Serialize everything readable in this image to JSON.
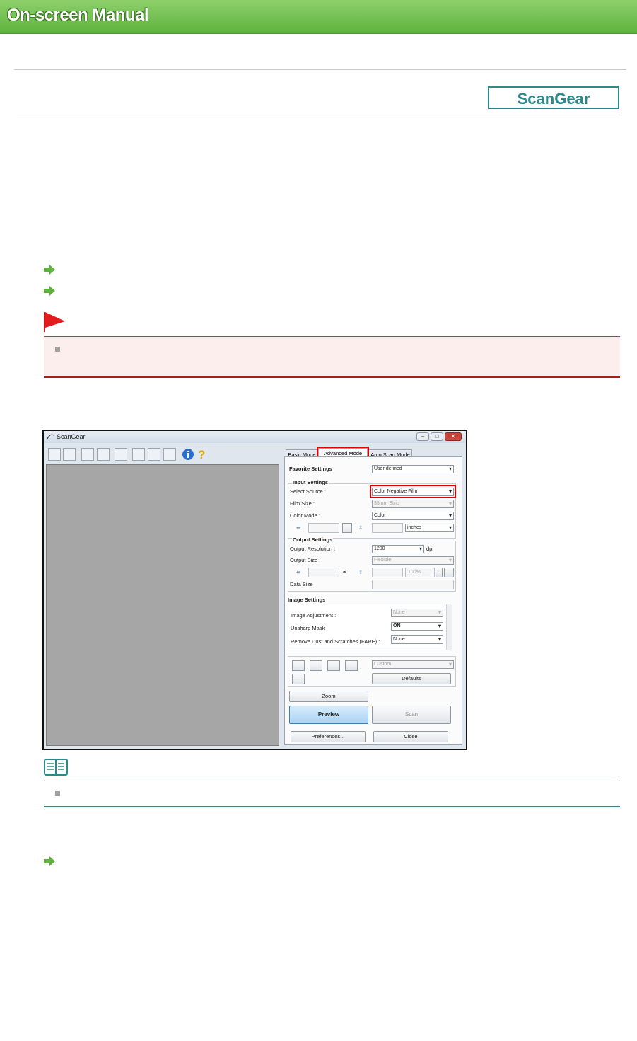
{
  "header": {
    "title": "On-screen Manual"
  },
  "badge": {
    "label": "ScanGear"
  },
  "window": {
    "title": "ScanGear",
    "tabs": [
      "Basic Mode",
      "Advanced Mode",
      "Auto Scan Mode"
    ],
    "favorite": {
      "label": "Favorite Settings",
      "value": "User defined"
    },
    "input": {
      "heading": "Input Settings",
      "select_source_label": "Select Source :",
      "select_source_value": "Color Negative Film",
      "film_size_label": "Film Size :",
      "film_size_value": "35mm Strip",
      "color_mode_label": "Color Mode :",
      "color_mode_value": "Color",
      "unit_value": "inches"
    },
    "output": {
      "heading": "Output Settings",
      "resolution_label": "Output Resolution :",
      "resolution_value": "1200",
      "resolution_unit": "dpi",
      "size_label": "Output Size :",
      "size_value": "Flexible",
      "scale_value": "100%",
      "data_size_label": "Data Size :"
    },
    "image": {
      "heading": "Image Settings",
      "adjustment_label": "Image Adjustment :",
      "adjustment_value": "None",
      "unsharp_label": "Unsharp Mask :",
      "unsharp_value": "ON",
      "dust_label": "Remove Dust and Scratches (FARE) :",
      "dust_value": "None"
    },
    "custom_value": "Custom",
    "defaults_label": "Defaults",
    "zoom_label": "Zoom",
    "preview_label": "Preview",
    "scan_label": "Scan",
    "preferences_label": "Preferences...",
    "close_label": "Close"
  },
  "colors": {
    "header_green": "#5fb23e",
    "badge_teal": "#2d8a8a",
    "note_red": "#a81e1e",
    "highlight": "#e00000"
  }
}
